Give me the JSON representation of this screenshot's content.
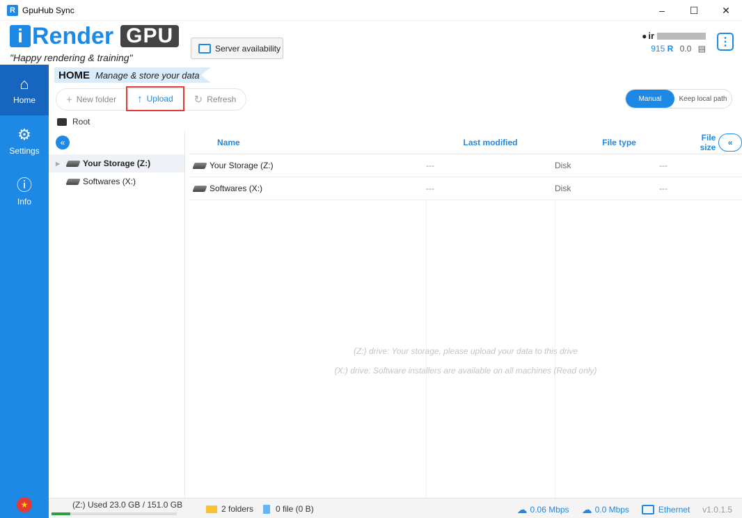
{
  "window": {
    "title": "GpuHub Sync",
    "app_icon": "R",
    "minimize": "–",
    "maximize": "☐",
    "close": "✕"
  },
  "header": {
    "logo_i": "i",
    "logo_text": "Render",
    "logo_gpu": "GPU",
    "tagline": "\"Happy rendering & training\"",
    "server_button": "Server availability",
    "user_prefix": "ir",
    "credits": "915",
    "credit_symbol": "R",
    "balance": "0.0",
    "more_icon": "⋮"
  },
  "sidebar": {
    "items": [
      {
        "label": "Home",
        "icon": "home-icon"
      },
      {
        "label": "Settings",
        "icon": "gear-icon"
      },
      {
        "label": "Info",
        "icon": "info-icon"
      }
    ]
  },
  "breadcrumb": {
    "title": "HOME",
    "subtitle": "Manage & store your data",
    "root": "Root"
  },
  "toolbar": {
    "new_folder": "New folder",
    "upload": "Upload",
    "refresh": "Refresh"
  },
  "mode_toggle": {
    "manual": "Manual",
    "keep_local": "Keep local path"
  },
  "tree": {
    "items": [
      {
        "label": "Your Storage (Z:)",
        "selected": true
      },
      {
        "label": "Softwares (X:)",
        "selected": false
      }
    ]
  },
  "table": {
    "columns": {
      "name": "Name",
      "modified": "Last modified",
      "type": "File type",
      "size": "File size"
    },
    "rows": [
      {
        "name": "Your Storage (Z:)",
        "modified": "---",
        "type": "Disk",
        "size": "---"
      },
      {
        "name": "Softwares (X:)",
        "modified": "---",
        "type": "Disk",
        "size": "---"
      }
    ],
    "hint_z": "(Z:) drive: Your storage, please upload your data to this drive",
    "hint_x": "(X:) drive: Software installers are available on all machines (Read only)"
  },
  "status": {
    "used": "(Z:) Used 23.0 GB / 151.0 GB",
    "used_fraction": 0.152,
    "folders": "2 folders",
    "files": "0 file (0 B)",
    "upload_speed": "0.06 Mbps",
    "download_speed": "0.0 Mbps",
    "network": "Ethernet",
    "version": "v1.0.1.5"
  },
  "colors": {
    "accent": "#1e88e5",
    "highlight": "#e53935"
  }
}
